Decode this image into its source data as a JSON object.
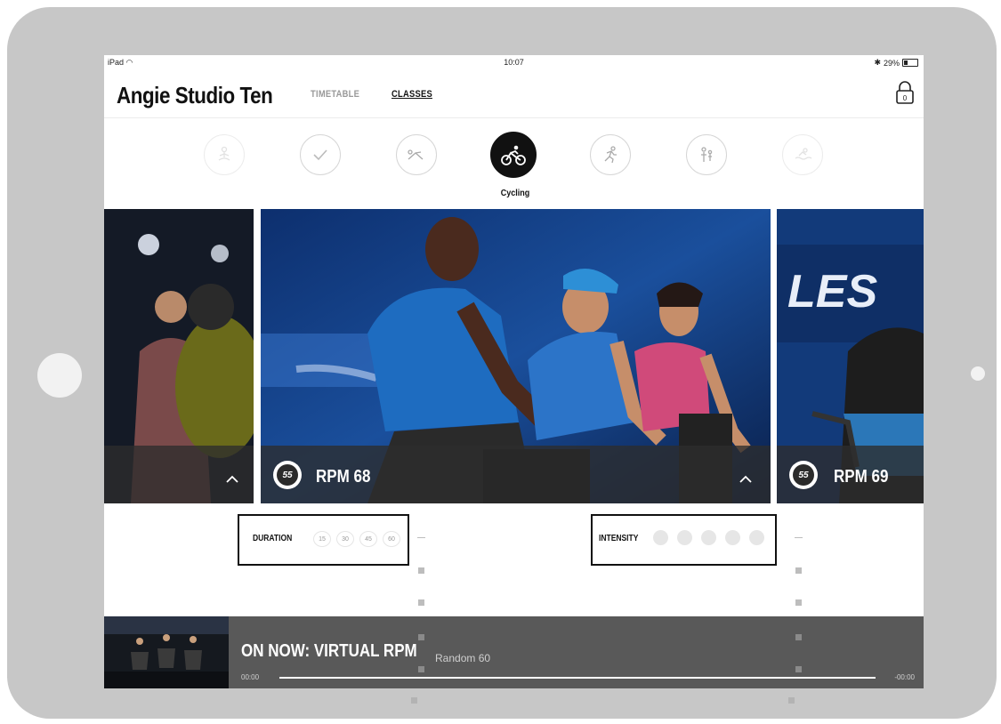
{
  "status_bar": {
    "device": "iPad",
    "time": "10:07",
    "battery": "29%"
  },
  "header": {
    "title": "Angie Studio Ten",
    "tabs": [
      {
        "label": "TIMETABLE",
        "active": false
      },
      {
        "label": "CLASSES",
        "active": true
      }
    ]
  },
  "categories": {
    "items": [
      {
        "icon": "meditation-icon",
        "state": "faded"
      },
      {
        "icon": "checkmark-icon",
        "state": "normal"
      },
      {
        "icon": "stretch-icon",
        "state": "normal"
      },
      {
        "icon": "cycling-icon",
        "state": "active",
        "label": "Cycling"
      },
      {
        "icon": "running-icon",
        "state": "normal"
      },
      {
        "icon": "family-icon",
        "state": "normal"
      },
      {
        "icon": "swimming-icon",
        "state": "faded"
      }
    ],
    "active_label": "Cycling"
  },
  "carousel": {
    "cards": [
      {
        "title": ""
      },
      {
        "title": "RPM 68",
        "duration_badge": "55"
      },
      {
        "title": "RPM 69",
        "duration_badge": "55"
      }
    ]
  },
  "filters": {
    "duration": {
      "label": "DURATION",
      "options": [
        "15",
        "30",
        "45",
        "60"
      ]
    },
    "intensity": {
      "label": "INTENSITY",
      "levels": 5
    }
  },
  "now_playing": {
    "title": "ON NOW: VIRTUAL RPM",
    "subtitle": "Random 60",
    "time_elapsed": "00:00",
    "time_remaining": "-00:00"
  },
  "colors": {
    "frame": "#c7c7c7",
    "overlay": "#2d2d2d",
    "now_bar": "#595959",
    "photo_blue": "#1a4f9c"
  }
}
